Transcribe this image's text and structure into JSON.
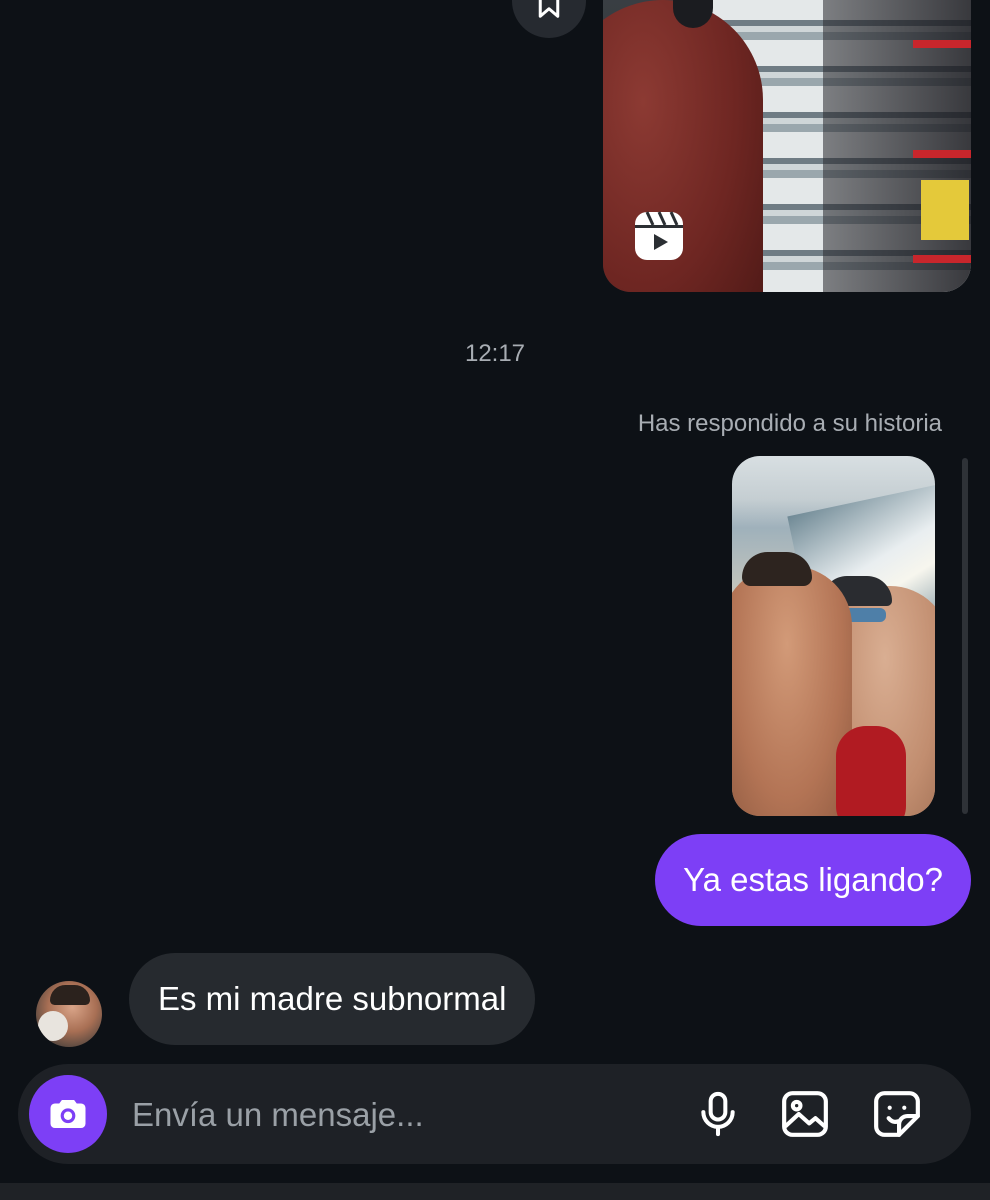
{
  "conversation": {
    "timestamp": "12:17",
    "reply_note": "Has respondido a su historia",
    "sent_message": "Ya estas ligando?",
    "received_message": "Es mi madre subnormal"
  },
  "composer": {
    "placeholder": "Envía un mensaje..."
  },
  "icons": {
    "save": "bookmark-icon",
    "reel": "reels-icon",
    "camera": "camera-icon",
    "mic": "microphone-icon",
    "gallery": "image-icon",
    "sticker": "sticker-icon"
  },
  "colors": {
    "background": "#0d1116",
    "sent_bubble": "#7d3ff6",
    "received_bubble": "#262a2f",
    "composer": "#1e2126",
    "muted_text": "#a8adb3"
  }
}
